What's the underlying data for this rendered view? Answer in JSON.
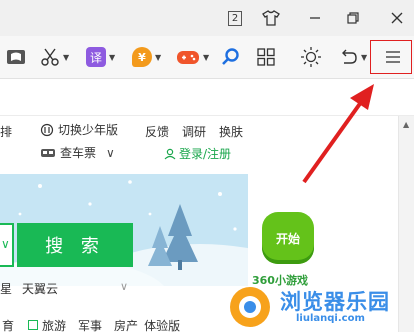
{
  "titlebar": {
    "tab_count": "2"
  },
  "toolbar": {
    "translate_label": "译",
    "yuan_label": "¥"
  },
  "page": {
    "links_row1": {
      "cut_label": "排",
      "youth_label": "切换少年版",
      "feedback_label": "反馈",
      "survey_label": "调研",
      "skin_label": "换肤"
    },
    "links_row2": {
      "ticket_label": "查车票",
      "login_label": "登录/注册"
    },
    "search": {
      "button_label": "搜 索",
      "suggestion_1": "星",
      "suggestion_2": "天翼云"
    },
    "games": {
      "start_label": "开始",
      "brand_label": "360小游戏"
    },
    "bottom_nav": [
      "育",
      "旅游",
      "军事",
      "房产",
      "体验版"
    ],
    "watermark": {
      "text": "浏览器乐园",
      "domain": "liulanqi.com"
    }
  },
  "colors": {
    "search_green": "#19b955",
    "highlight_red": "#e02020",
    "banner_sky": "#c6e5f4"
  }
}
